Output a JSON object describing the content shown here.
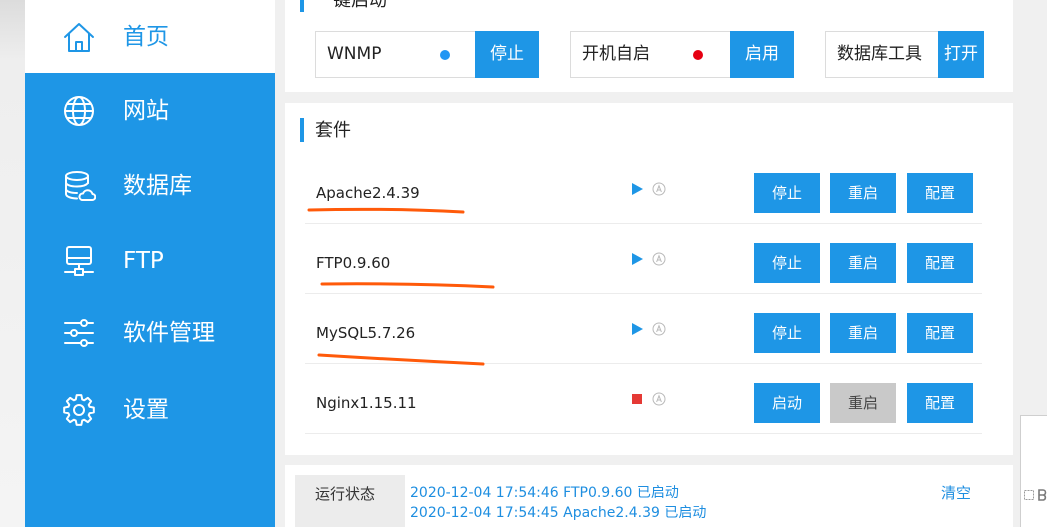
{
  "colors": {
    "accent": "#1e96e6",
    "running": "#1e96e6",
    "stopped": "#e53935",
    "disabled_button": "#c9c9c9",
    "log_text": "#1e8ee0",
    "annotation": "#ff5a0a"
  },
  "sidebar": {
    "items": [
      {
        "label": "首页",
        "icon": "home-icon",
        "active": true
      },
      {
        "label": "网站",
        "icon": "globe-icon"
      },
      {
        "label": "数据库",
        "icon": "database-icon"
      },
      {
        "label": "FTP",
        "icon": "monitor-icon"
      },
      {
        "label": "软件管理",
        "icon": "sliders-icon"
      },
      {
        "label": "设置",
        "icon": "gear-icon"
      }
    ]
  },
  "quick_start": {
    "title": "一键启动",
    "groups": [
      {
        "label": "WNMP",
        "status_color": "#2196f3",
        "button": "停止"
      },
      {
        "label": "开机自启",
        "status_color": "#e60012",
        "button": "启用"
      },
      {
        "label": "数据库工具",
        "button": "打开"
      }
    ]
  },
  "suite": {
    "title": "套件",
    "rows": [
      {
        "name": "Apache2.4.39",
        "running": true,
        "state_icon": "play-icon",
        "auto_icon": "auto-start-icon",
        "buttons": [
          "停止",
          "重启",
          "配置"
        ],
        "underlined": true
      },
      {
        "name": "FTP0.9.60",
        "running": true,
        "state_icon": "play-icon",
        "auto_icon": "auto-start-icon",
        "buttons": [
          "停止",
          "重启",
          "配置"
        ],
        "underlined": true
      },
      {
        "name": "MySQL5.7.26",
        "running": true,
        "state_icon": "play-icon",
        "auto_icon": "auto-start-icon",
        "buttons": [
          "停止",
          "重启",
          "配置"
        ],
        "underlined": true
      },
      {
        "name": "Nginx1.15.11",
        "running": false,
        "state_icon": "stop-icon",
        "auto_icon": "auto-start-icon",
        "buttons": [
          "启动",
          "重启",
          "配置"
        ],
        "restart_disabled": true,
        "underlined": false
      }
    ]
  },
  "status": {
    "label": "运行状态",
    "log": [
      "2020-12-04 17:54:46 FTP0.9.60 已启动",
      "2020-12-04 17:54:45 Apache2.4.39 已启动"
    ],
    "clear_button": "清空"
  },
  "edge_panel": {
    "icons": [
      "capture-icon",
      "bold-icon"
    ]
  }
}
